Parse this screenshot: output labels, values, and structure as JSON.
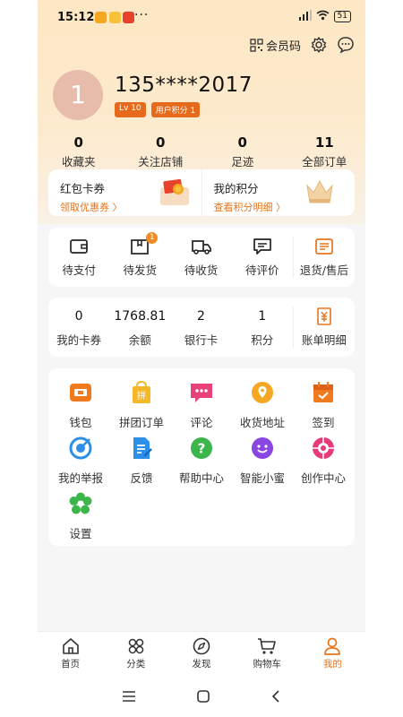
{
  "status": {
    "time": "15:12",
    "battery": "51",
    "dots": "···"
  },
  "header": {
    "member_code_label": "会员码"
  },
  "user": {
    "avatar_text": "1",
    "phone": "135****2017",
    "level": "Lv 10",
    "points_badge": "用户积分 1"
  },
  "stats": [
    {
      "value": "0",
      "label": "收藏夹"
    },
    {
      "value": "0",
      "label": "关注店铺"
    },
    {
      "value": "0",
      "label": "足迹"
    },
    {
      "value": "11",
      "label": "全部订单"
    }
  ],
  "promo": {
    "coupon_title": "红包卡券",
    "coupon_link": "领取优惠券 〉",
    "points_title": "我的积分",
    "points_link": "查看积分明细 〉"
  },
  "orders": [
    {
      "label": "待支付"
    },
    {
      "label": "待发货",
      "badge": "1"
    },
    {
      "label": "待收货"
    },
    {
      "label": "待评价"
    },
    {
      "label": "退货/售后"
    }
  ],
  "wallet": [
    {
      "value": "0",
      "label": "我的卡券"
    },
    {
      "value": "1768.81",
      "label": "余额"
    },
    {
      "value": "2",
      "label": "银行卡"
    },
    {
      "value": "1",
      "label": "积分"
    },
    {
      "label": "账单明细"
    }
  ],
  "services": [
    {
      "label": "钱包",
      "icon": "wallet-icon",
      "color": "#f07a1e"
    },
    {
      "label": "拼团订单",
      "icon": "group-order-icon",
      "color": "#f5b82a"
    },
    {
      "label": "评论",
      "icon": "comment-icon",
      "color": "#e8427a"
    },
    {
      "label": "收货地址",
      "icon": "location-icon",
      "color": "#f5a623"
    },
    {
      "label": "签到",
      "icon": "calendar-icon",
      "color": "#f07a1e"
    },
    {
      "label": "我的举报",
      "icon": "report-icon",
      "color": "#2d8fe8"
    },
    {
      "label": "反馈",
      "icon": "feedback-icon",
      "color": "#2d8fe8"
    },
    {
      "label": "帮助中心",
      "icon": "help-icon",
      "color": "#3cb54a"
    },
    {
      "label": "智能小蜜",
      "icon": "assistant-icon",
      "color": "#8a46e0"
    },
    {
      "label": "创作中心",
      "icon": "create-icon",
      "color": "#e83a7a"
    },
    {
      "label": "设置",
      "icon": "settings-icon",
      "color": "#3cb54a"
    }
  ],
  "tabs": [
    {
      "label": "首页",
      "icon": "home-icon"
    },
    {
      "label": "分类",
      "icon": "category-icon"
    },
    {
      "label": "发现",
      "icon": "discover-icon"
    },
    {
      "label": "购物车",
      "icon": "cart-icon"
    },
    {
      "label": "我的",
      "icon": "profile-icon",
      "active": true
    }
  ],
  "colors": {
    "accent": "#e8741c",
    "header_bg": "#fde7c4"
  }
}
